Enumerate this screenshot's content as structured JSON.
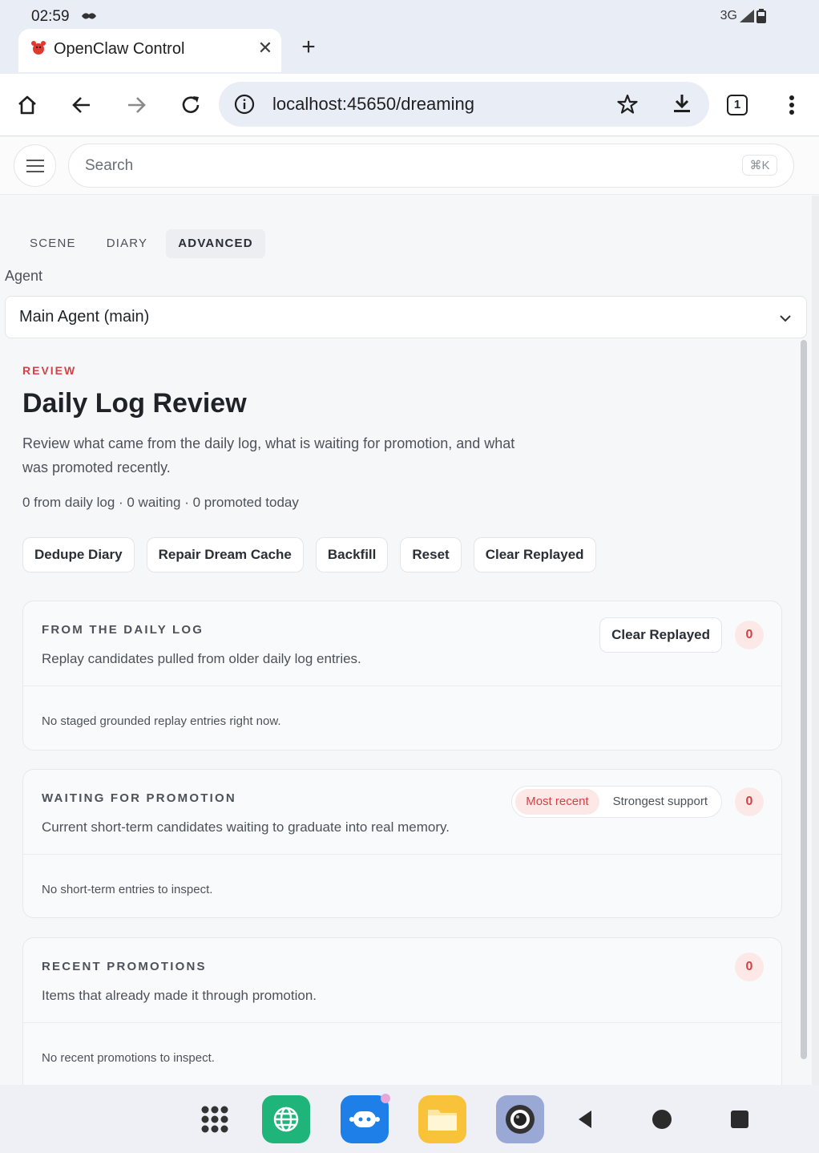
{
  "status_bar": {
    "time": "02:59",
    "network": "3G"
  },
  "browser": {
    "tab_title": "OpenClaw Control",
    "url": "localhost:45650/dreaming",
    "tab_count": "1"
  },
  "app_header": {
    "search_placeholder": "Search",
    "search_shortcut": "⌘K"
  },
  "nav_tabs": [
    {
      "label": "SCENE"
    },
    {
      "label": "DIARY"
    },
    {
      "label": "ADVANCED",
      "active": true
    }
  ],
  "agent": {
    "label": "Agent",
    "selected": "Main Agent (main)"
  },
  "review": {
    "eyebrow": "REVIEW",
    "title": "Daily Log Review",
    "description": "Review what came from the daily log, what is waiting for promotion, and what was promoted recently.",
    "stats": "0 from daily log · 0 waiting · 0 promoted today",
    "actions": [
      "Dedupe Diary",
      "Repair Dream Cache",
      "Backfill",
      "Reset",
      "Clear Replayed"
    ]
  },
  "cards": {
    "daily_log": {
      "title": "FROM THE DAILY LOG",
      "subtitle": "Replay candidates pulled from older daily log entries.",
      "button": "Clear Replayed",
      "count": "0",
      "empty": "No staged grounded replay entries right now."
    },
    "waiting": {
      "title": "WAITING FOR PROMOTION",
      "subtitle": "Current short-term candidates waiting to graduate into real memory.",
      "sort_options": [
        "Most recent",
        "Strongest support"
      ],
      "sort_selected": "Most recent",
      "count": "0",
      "empty": "No short-term entries to inspect."
    },
    "recent": {
      "title": "RECENT PROMOTIONS",
      "subtitle": "Items that already made it through promotion.",
      "count": "0",
      "empty": "No recent promotions to inspect."
    }
  },
  "colors": {
    "accent": "#d14343",
    "accent_bg": "#fde8e8"
  }
}
